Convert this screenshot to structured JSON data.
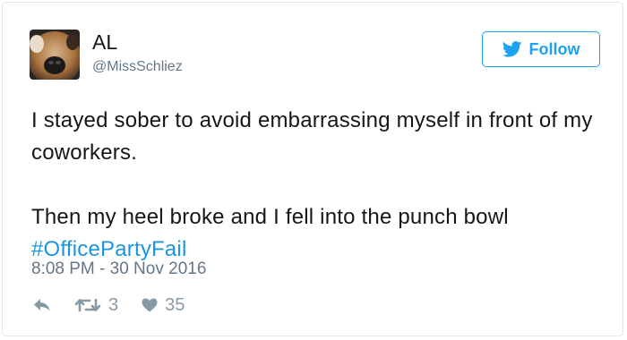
{
  "user": {
    "name": "AL",
    "handle": "@MissSchliez"
  },
  "follow_button": {
    "label": "Follow",
    "icon": "twitter-bird-icon"
  },
  "tweet": {
    "line1": "I stayed sober to avoid embarrassing myself in front of my coworkers.",
    "line2": "Then my heel broke and I fell into the punch bowl",
    "hashtag": "#OfficePartyFail",
    "timestamp": "8:08 PM - 30 Nov 2016"
  },
  "actions": {
    "reply_icon": "reply-icon",
    "retweet_icon": "retweet-icon",
    "retweet_count": "3",
    "like_icon": "heart-icon",
    "like_count": "35"
  },
  "colors": {
    "accent": "#1da1f2",
    "hashtag": "#1b95e0",
    "muted": "#657786",
    "icon": "#8899a6",
    "text": "#14171a"
  }
}
